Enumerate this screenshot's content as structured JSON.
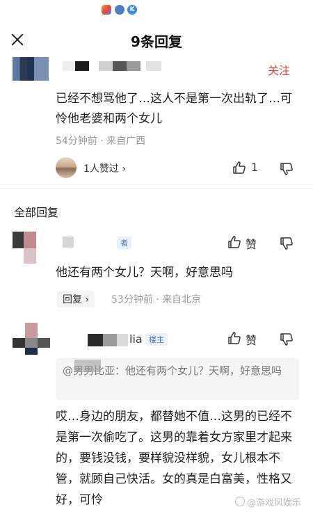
{
  "header": {
    "title": "9条回复"
  },
  "main_comment": {
    "follow_label": "关注",
    "text": "已经不想骂他了…这人不是第一次出轨了…可怜他老婆和两个女儿",
    "meta": "54分钟前 · 来自广西",
    "likers_text": "1人赞过 ›",
    "like_count": "1"
  },
  "section": {
    "title": "全部回复"
  },
  "reply1": {
    "tag": "者",
    "like_label": "赞",
    "text": "他还有两个女儿？天啊，好意思吗",
    "reply_label": "回复 ›",
    "meta": "53分钟前 · 来自北京"
  },
  "reply2": {
    "name_fragment": "lia",
    "tag": "楼主",
    "like_label": "赞",
    "quote": "@男男比亚：他还有两个女儿？天啊，好意思吗",
    "text": "哎…身边的朋友，都替她不值…这男的已经不是第一次偷吃了。这男的靠着女方家里才起来的，要钱没钱，要样貌没样貌，女儿根本不管，就顾自己快活。女的真是白富美，性格又好，可怜"
  },
  "watermark": {
    "text": "@游戏风娱乐"
  }
}
